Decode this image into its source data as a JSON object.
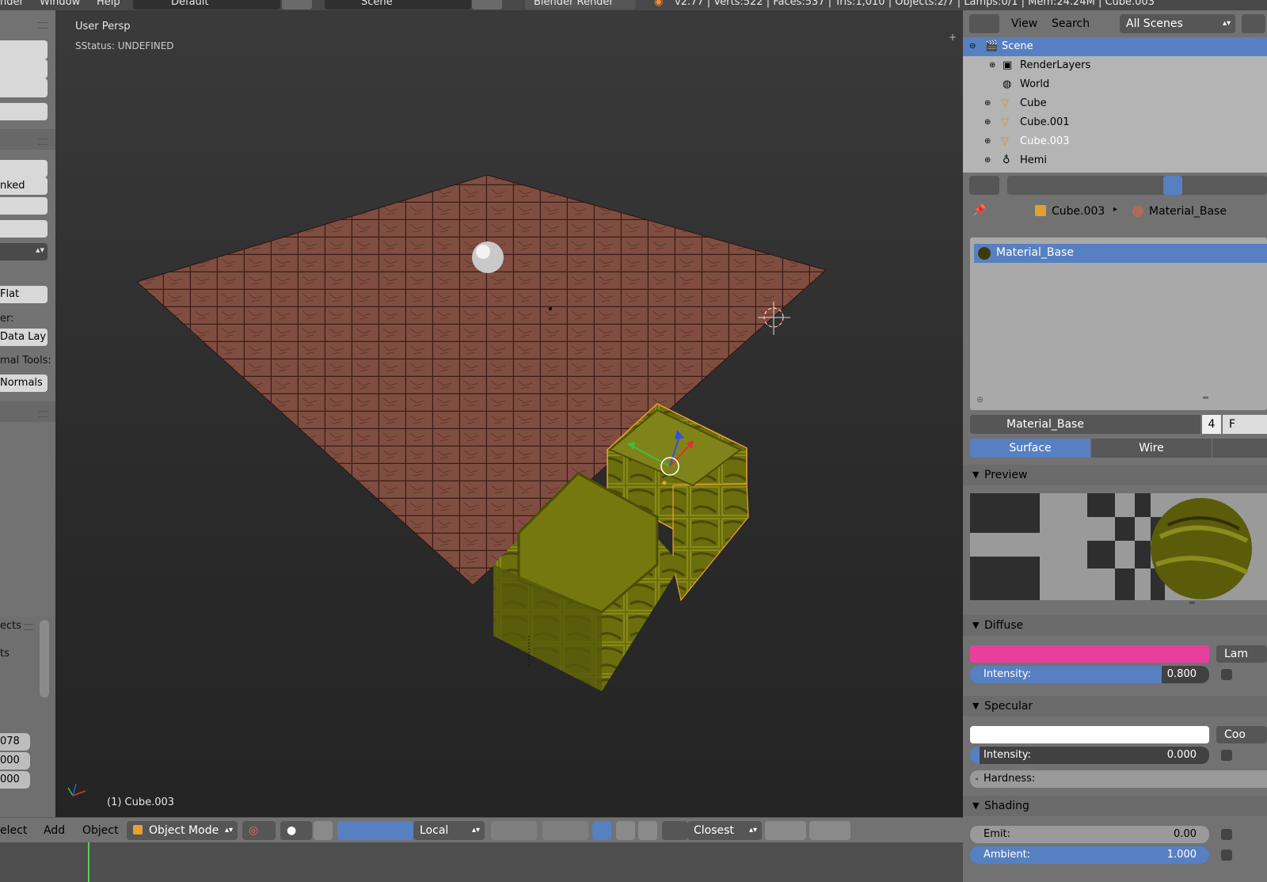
{
  "topbar": {
    "menu_render": "nder",
    "menu_window": "Window",
    "menu_help": "Help",
    "layout": "Default",
    "scene": "Scene",
    "engine": "Blender Render",
    "stats": "v2.77 | Verts:522 | Faces:537 | Tris:1,010 | Objects:2/7 | Lamps:0/1 | Mem:24.24M | Cube.003"
  },
  "shelf": {
    "linked": "nked",
    "flat": "Flat",
    "er_label": "er:",
    "data_lay": "Data Lay",
    "normal_tools": "mal Tools:",
    "normals": "Normals",
    "objects": "ects",
    "ts": "ts",
    "num1": "078",
    "num2": "000",
    "num3": "000"
  },
  "viewport": {
    "view_name": "User Persp",
    "status": "SStatus: UNDEFINED",
    "active_object": "(1) Cube.003"
  },
  "header": {
    "select": "elect",
    "add": "Add",
    "object": "Object",
    "mode": "Object Mode",
    "pivot": "Local",
    "snap": "Closest"
  },
  "outliner": {
    "view": "View",
    "search": "Search",
    "filter": "All Scenes",
    "items": [
      {
        "label": "Scene"
      },
      {
        "label": "RenderLayers"
      },
      {
        "label": "World"
      },
      {
        "label": "Cube"
      },
      {
        "label": "Cube.001"
      },
      {
        "label": "Cube.003"
      },
      {
        "label": "Hemi"
      }
    ]
  },
  "properties": {
    "breadcrumb_object": "Cube.003",
    "breadcrumb_material": "Material_Base",
    "slot": "Material_Base",
    "material_name": "Material_Base",
    "users": "4",
    "fake": "F",
    "tabs": [
      "Surface",
      "Wire"
    ],
    "preview": "Preview",
    "diffuse": {
      "title": "Diffuse",
      "color": "#e83f9f",
      "shader": "Lam",
      "intensity_label": "Intensity:",
      "intensity": "0.800"
    },
    "specular": {
      "title": "Specular",
      "color": "#ffffff",
      "shader": "Coo",
      "intensity_label": "Intensity:",
      "intensity": "0.000",
      "hardness_label": "Hardness:"
    },
    "shading": {
      "title": "Shading",
      "emit_label": "Emit:",
      "emit": "0.00",
      "ambient_label": "Ambient:",
      "ambient": "1.000"
    }
  }
}
